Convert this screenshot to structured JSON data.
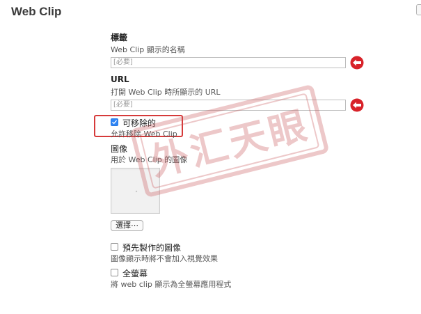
{
  "page": {
    "title": "Web Clip"
  },
  "label_section": {
    "heading": "標籤",
    "description": "Web Clip 顯示的名稱",
    "placeholder": "[必要]"
  },
  "url_section": {
    "heading": "URL",
    "description": "打開 Web Clip 時所顯示的 URL",
    "placeholder": "[必要]"
  },
  "removable": {
    "label": "可移除的",
    "description": "允許移除 Web Clip",
    "checked": true
  },
  "image_section": {
    "heading": "圖像",
    "description": "用於 Web Clip 的圖像",
    "choose_button": "選擇⋯"
  },
  "precomposed": {
    "label": "預先製作的圖像",
    "description": "圖像顯示時將不會加入視覺效果",
    "checked": false
  },
  "fullscreen": {
    "label": "全螢幕",
    "description": "將 web clip 顯示為全螢幕應用程式",
    "checked": false
  },
  "watermark": {
    "text": "外汇天眼"
  },
  "colors": {
    "required_icon": "#d8232a",
    "checkbox_checked": "#2f86f6",
    "highlight": "#d63a3a",
    "watermark": "#c9575a"
  },
  "icons": {
    "required": "required-arrow-icon",
    "checkmark": "checkmark-icon",
    "image_placeholder": "image-placeholder-icon"
  }
}
